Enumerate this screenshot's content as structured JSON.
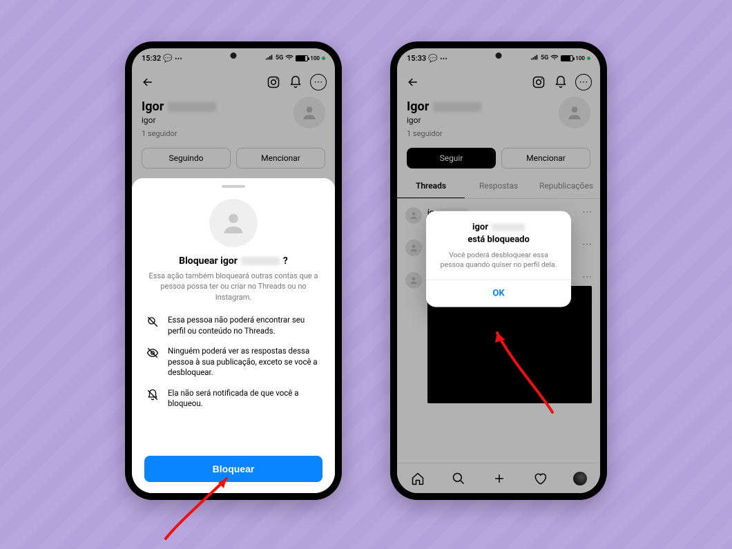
{
  "statusbar": {
    "time_left": "15:32",
    "time_right": "15:33",
    "network_label": "5G",
    "battery_label": "100"
  },
  "header": {
    "instagram_icon": "instagram-icon",
    "bell_icon": "bell-icon",
    "more_icon": "more-icon",
    "back_icon": "back-icon"
  },
  "profile": {
    "display_name": "Igor",
    "handle": "igor",
    "followers_text": "1 seguidor"
  },
  "buttons": {
    "following": "Seguindo",
    "follow": "Seguir",
    "mention": "Mencionar"
  },
  "tabs": {
    "threads": "Threads",
    "replies": "Respostas",
    "reposts": "Republicações"
  },
  "sheet": {
    "title_prefix": "Bloquear igor",
    "title_suffix": "?",
    "subtitle": "Essa ação também bloqueará outras contas que a pessoa possa ter ou criar no Threads ou no Instagram.",
    "items": [
      "Essa pessoa não poderá encontrar seu perfil ou conteúdo no Threads.",
      "Ninguém poderá ver as respostas dessa pessoa à sua publicação, exceto se você a desbloquear.",
      "Ela não será notificada de que você a bloqueou."
    ],
    "block_button": "Bloquear"
  },
  "alert": {
    "title_line1_prefix": "igor",
    "title_line2": "está bloqueado",
    "message": "Você poderá desbloquear essa pessoa quando quiser no perfil dela.",
    "ok": "OK"
  }
}
